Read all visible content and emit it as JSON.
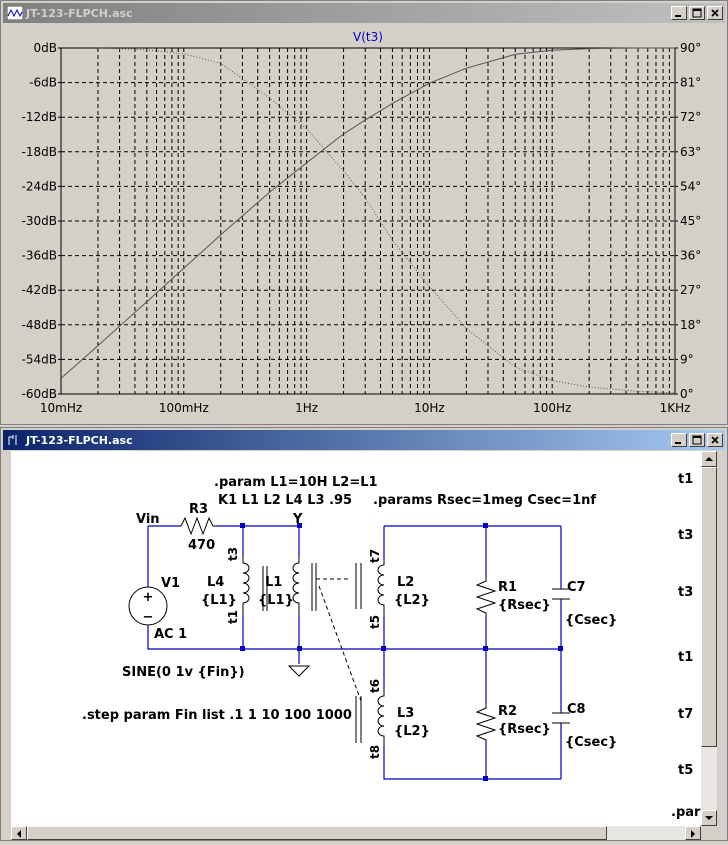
{
  "windows": {
    "plot": {
      "title": "JT-123-FLPCH.asc"
    },
    "schematic": {
      "title": "JT-123-FLPCH.asc"
    }
  },
  "colors": {
    "titlebar_active": "#0a246a",
    "titlebar_inactive": "#808080",
    "trace_label": "#0000c0",
    "wire": "#0000c0",
    "component": "#000000"
  },
  "chart_data": {
    "type": "line",
    "title": "V(t3)",
    "x_scale": "log",
    "xlim": [
      0.01,
      1000
    ],
    "x_tick_labels": [
      "10mHz",
      "100mHz",
      "1Hz",
      "10Hz",
      "100Hz",
      "1KHz"
    ],
    "ylim_left": [
      -60,
      0
    ],
    "y_left_tick_labels": [
      "0dB",
      "-6dB",
      "-12dB",
      "-18dB",
      "-24dB",
      "-30dB",
      "-36dB",
      "-42dB",
      "-48dB",
      "-54dB",
      "-60dB"
    ],
    "ylim_right": [
      0,
      90
    ],
    "y_right_tick_labels": [
      "90°",
      "81°",
      "72°",
      "63°",
      "54°",
      "45°",
      "36°",
      "27°",
      "18°",
      "9°",
      "0°"
    ],
    "grid": true,
    "series": [
      {
        "style": "solid",
        "axis": "left",
        "x": [
          0.01,
          0.02,
          0.05,
          0.1,
          0.2,
          0.5,
          1,
          2,
          3,
          5,
          10,
          20,
          50,
          100,
          200,
          500,
          1000
        ],
        "y": [
          -57.3,
          -51.6,
          -44.0,
          -38.2,
          -32.4,
          -25.0,
          -19.9,
          -14.9,
          -12.5,
          -9.6,
          -6.1,
          -3.5,
          -1.1,
          -0.4,
          -0.1,
          0,
          0
        ]
      },
      {
        "style": "dotted",
        "axis": "right",
        "x": [
          0.02,
          0.05,
          0.1,
          0.2,
          0.5,
          1,
          2,
          3,
          5,
          10,
          20,
          50,
          100,
          200,
          500,
          1000
        ],
        "y": [
          90,
          89.5,
          88.5,
          86,
          77,
          69,
          58,
          51,
          40,
          28,
          17,
          7,
          3.5,
          1.8,
          0.7,
          0.3
        ]
      }
    ]
  },
  "schematic": {
    "directives": {
      "param": ".param L1=10H L2=L1",
      "coupling": "K1 L1 L2 L4  L3 .95",
      "params": ".params Rsec=1meg Csec=1nf",
      "step": ".step param Fin list .1 1 10 100 1000"
    },
    "net_labels": {
      "vin": "Vin",
      "y": "Y",
      "t1_left": "t1",
      "t3_left": "t3",
      "t5": "t5",
      "t7": "t7",
      "t6": "t6",
      "t8": "t8"
    },
    "source": {
      "name": "V1",
      "ac": "AC 1",
      "sine": "SINE(0 1v {Fin})"
    },
    "components": [
      {
        "name": "R3",
        "value": "470"
      },
      {
        "name": "L4",
        "value": "{L1}"
      },
      {
        "name": "L1",
        "value": "{L1}"
      },
      {
        "name": "L2",
        "value": "{L2}"
      },
      {
        "name": "L3",
        "value": "{L2}"
      },
      {
        "name": "R1",
        "value": "{Rsec}"
      },
      {
        "name": "R2",
        "value": "{Rsec}"
      },
      {
        "name": "C7",
        "value": "{Csec}"
      },
      {
        "name": "C8",
        "value": "{Csec}"
      }
    ],
    "edge_labels": [
      "t1",
      "t3",
      "t3",
      "t1",
      "t7",
      "t5",
      ".para"
    ]
  }
}
